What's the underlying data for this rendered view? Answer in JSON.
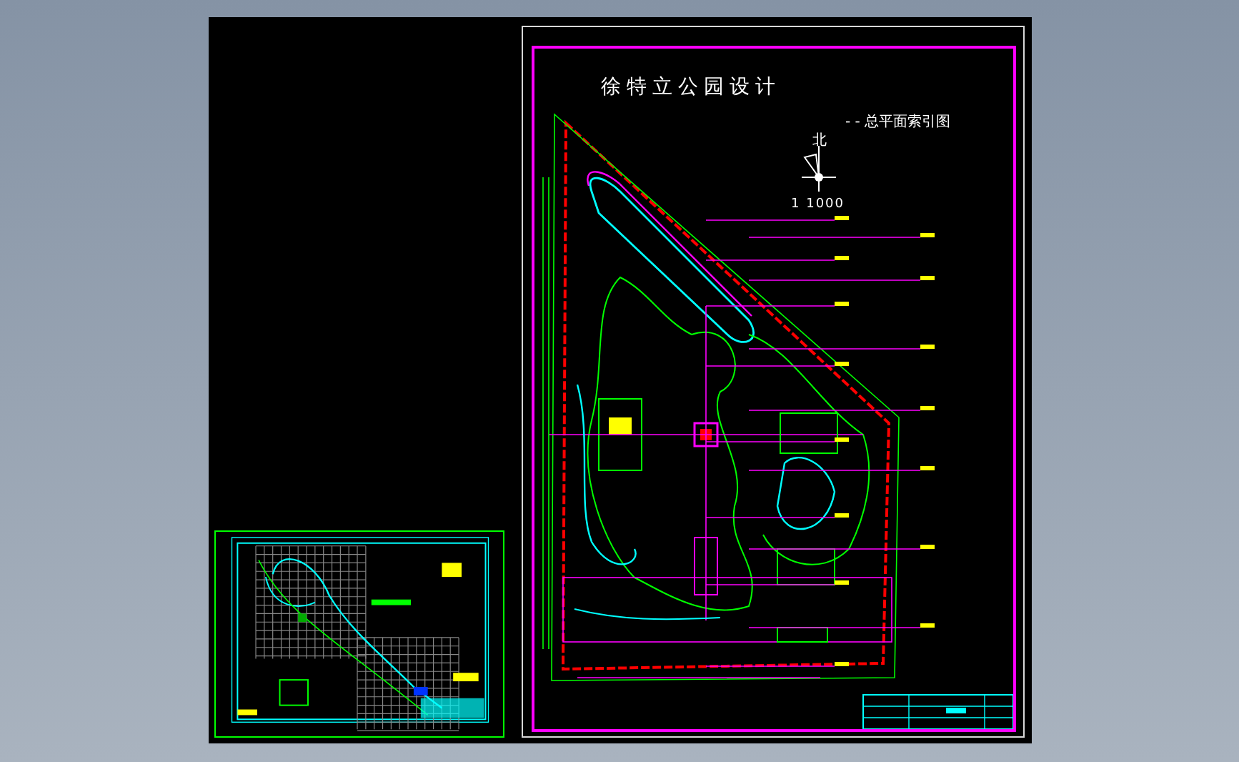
{
  "sheet": {
    "title": "徐特立公园设计",
    "subtitle": "- - 总平面索引图"
  },
  "north_arrow": {
    "label": "北"
  },
  "scale": "1 1000"
}
